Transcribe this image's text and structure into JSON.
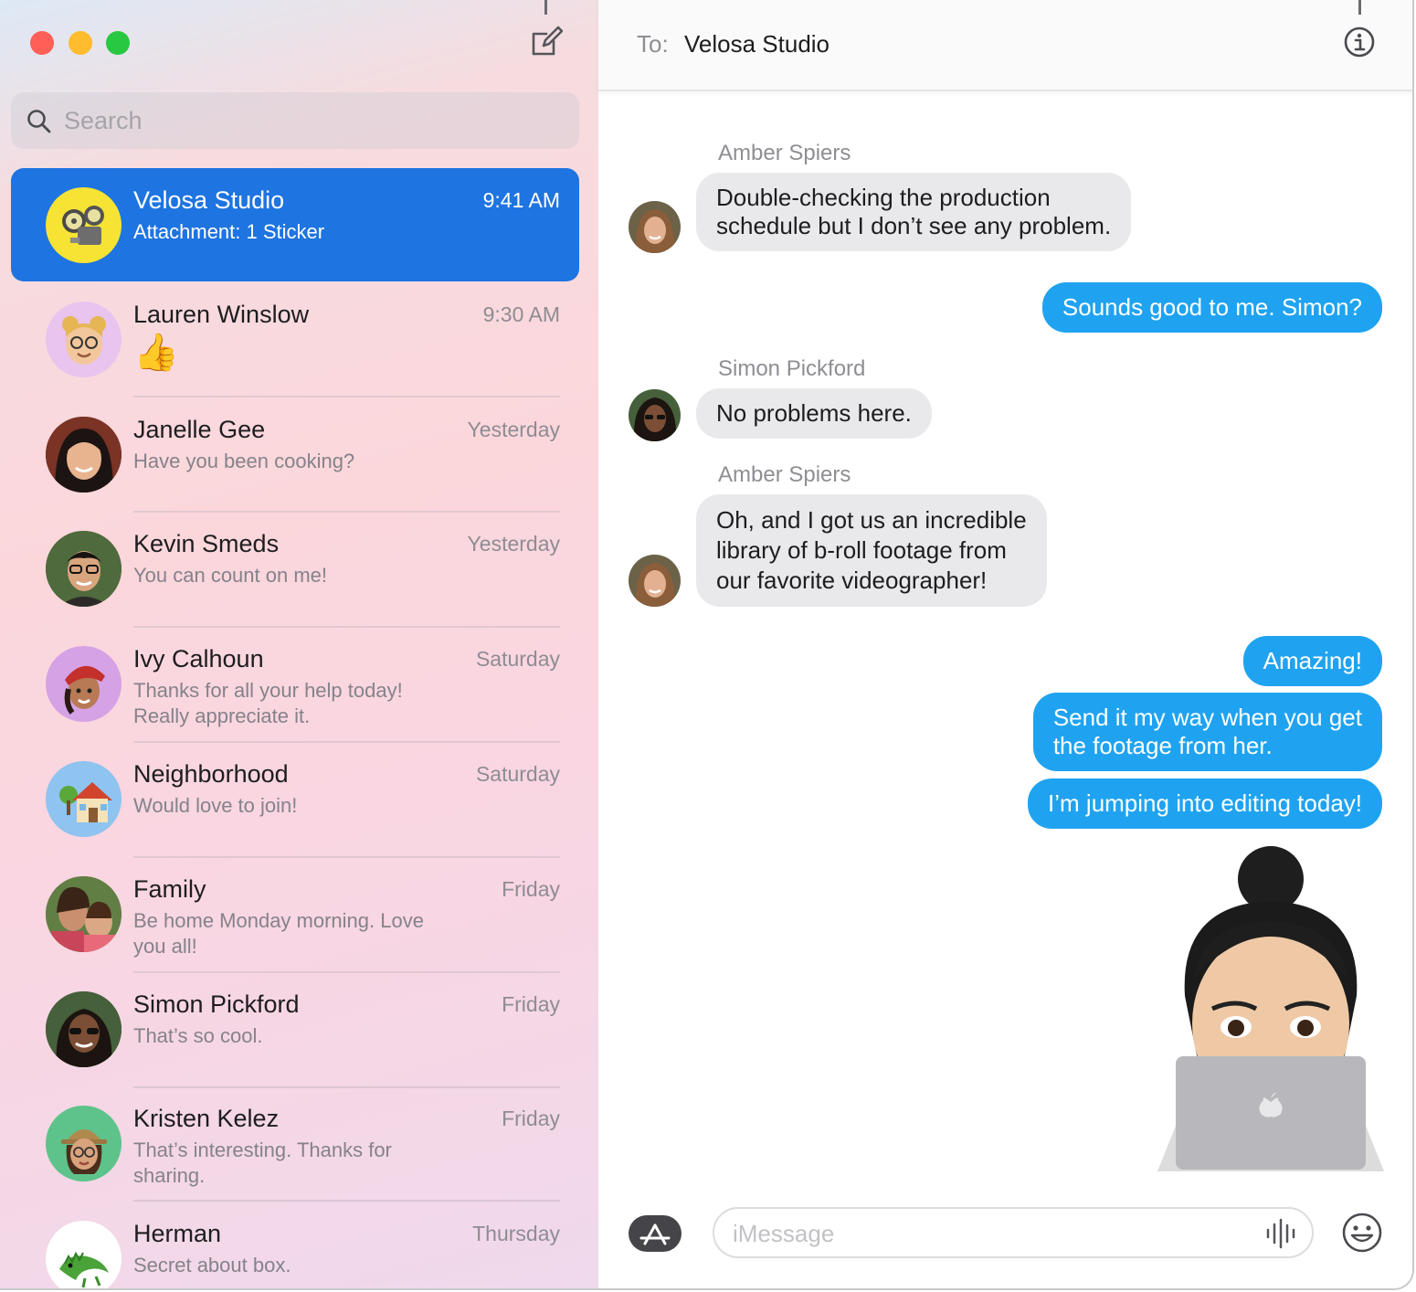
{
  "window": {
    "traffic_lights": {
      "close_color": "#ff5f57",
      "minimize_color": "#febc2e",
      "zoom_color": "#28c840"
    },
    "compose_icon": "compose-icon"
  },
  "search": {
    "placeholder": "Search",
    "value": "",
    "icon": "search-icon"
  },
  "conversations": [
    {
      "name": "Velosa Studio",
      "time": "9:41 AM",
      "preview": "Attachment: 1 Sticker",
      "selected": true,
      "avatar": "film-projector-sticker"
    },
    {
      "name": "Lauren Winslow",
      "time": "9:30 AM",
      "preview": "👍",
      "avatar": "memoji-lauren"
    },
    {
      "name": "Janelle Gee",
      "time": "Yesterday",
      "preview": "Have you been cooking?",
      "avatar": "photo-janelle"
    },
    {
      "name": "Kevin Smeds",
      "time": "Yesterday",
      "preview": "You can count on me!",
      "avatar": "photo-kevin"
    },
    {
      "name": "Ivy Calhoun",
      "time": "Saturday",
      "preview": "Thanks for all your help today! Really appreciate it.",
      "avatar": "memoji-ivy"
    },
    {
      "name": "Neighborhood",
      "time": "Saturday",
      "preview": "Would love to join!",
      "avatar": "house-emoji"
    },
    {
      "name": "Family",
      "time": "Friday",
      "preview": "Be home Monday morning. Love you all!",
      "avatar": "photo-family"
    },
    {
      "name": "Simon Pickford",
      "time": "Friday",
      "preview": "That’s so cool.",
      "avatar": "photo-simon"
    },
    {
      "name": "Kristen Kelez",
      "time": "Friday",
      "preview": "That’s interesting. Thanks for sharing.",
      "avatar": "memoji-kristen"
    },
    {
      "name": "Herman",
      "time": "Thursday",
      "preview": "Secret about box.",
      "avatar": "lizard-emoji"
    }
  ],
  "header": {
    "to_label": "To:",
    "recipient": "Velosa Studio",
    "info_icon": "info-icon"
  },
  "messages": [
    {
      "sender": "Amber Spiers",
      "direction": "incoming",
      "text": "Double-checking the production\nschedule but I don’t see any problem."
    },
    {
      "direction": "outgoing",
      "text": "Sounds good to me. Simon?"
    },
    {
      "sender": "Simon Pickford",
      "direction": "incoming",
      "text": "No problems here."
    },
    {
      "sender": "Amber Spiers",
      "direction": "incoming",
      "text": "Oh, and I got us an incredible\nlibrary of b-roll footage from\nour favorite videographer!"
    },
    {
      "direction": "outgoing",
      "text": "Amazing!"
    },
    {
      "direction": "outgoing",
      "text": "Send it my way when you get\nthe footage from her."
    },
    {
      "direction": "outgoing",
      "text": "I’m jumping into editing today!"
    }
  ],
  "sticker": "memoji-laptop-sticker",
  "composer": {
    "placeholder": "iMessage",
    "value": "",
    "apps_icon": "app-store-icon",
    "audio_icon": "waveform-icon",
    "emoji_icon": "emoji-icon"
  },
  "colors": {
    "selected_row": "#1e74e0",
    "outgoing_bubble": "#1fa3f0",
    "incoming_bubble": "#e9e9eb"
  }
}
